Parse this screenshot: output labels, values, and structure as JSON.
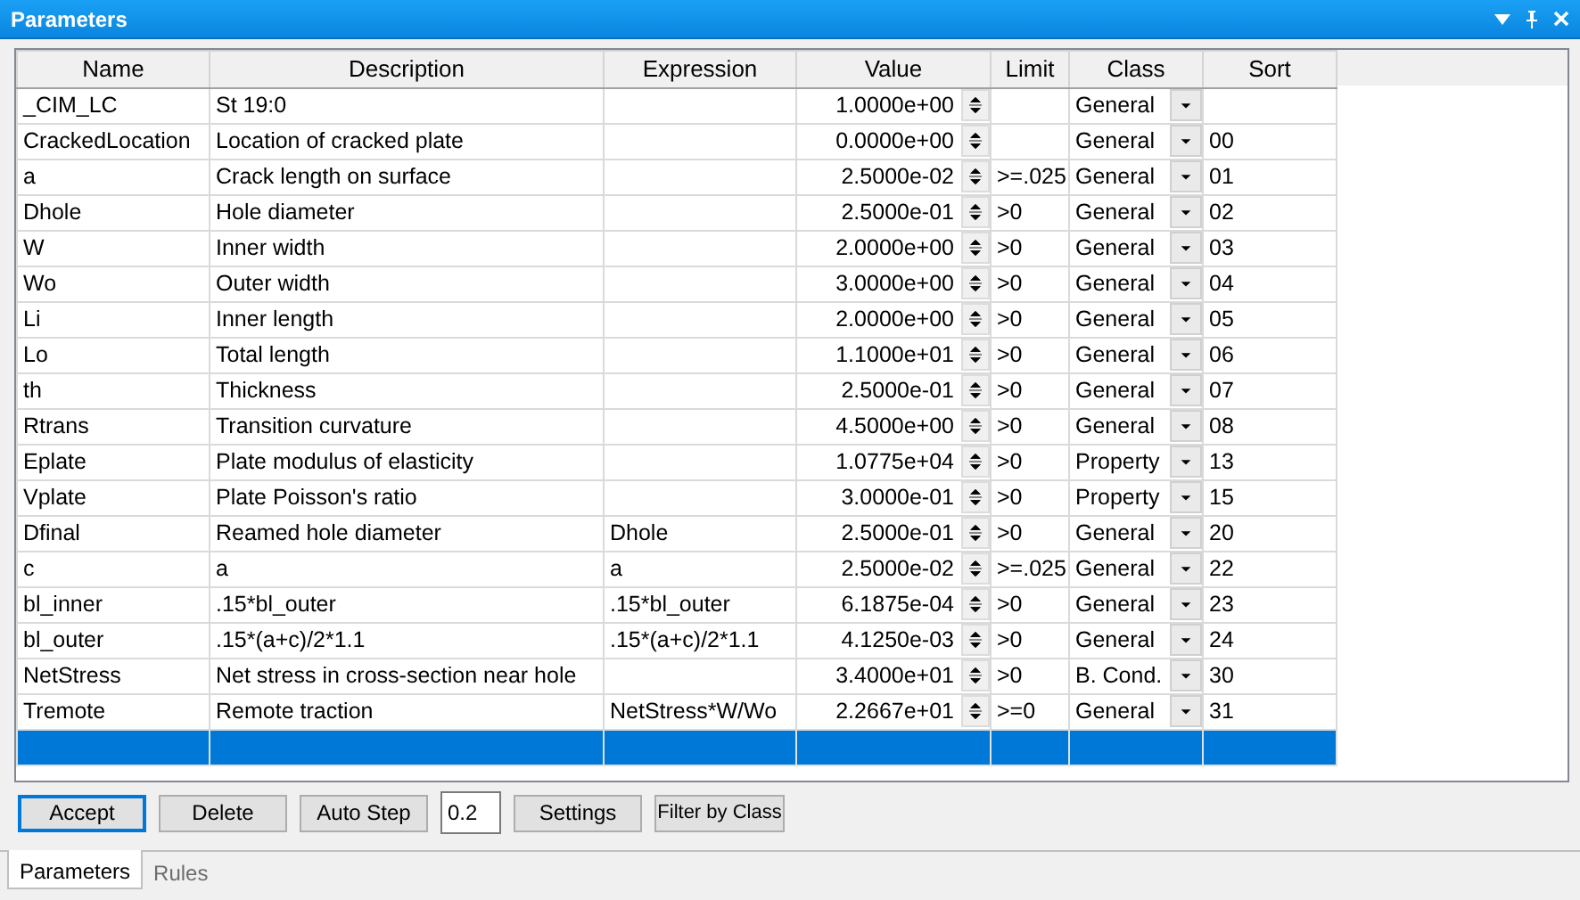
{
  "window": {
    "title": "Parameters"
  },
  "table": {
    "columns": [
      "Name",
      "Description",
      "Expression",
      "Value",
      "Limit",
      "Class",
      "Sort"
    ],
    "rows": [
      {
        "name": "_CIM_LC",
        "description": "St 19:0",
        "value": "1.0000e+00",
        "class": "General",
        "selected": false
      },
      {
        "name": "CrackedLocation",
        "description": "Location of cracked plate",
        "value": "0.0000e+00",
        "class": "General",
        "sort": "00",
        "selected": false
      },
      {
        "name": "a",
        "description": "Crack length on surface",
        "value": "2.5000e-02",
        "limit": ">=.025",
        "class": "General",
        "sort": "01",
        "selected": false
      },
      {
        "name": "Dhole",
        "description": "Hole diameter",
        "value": "2.5000e-01",
        "limit": ">0",
        "class": "General",
        "sort": "02",
        "selected": false
      },
      {
        "name": "W",
        "description": "Inner width",
        "value": "2.0000e+00",
        "limit": ">0",
        "class": "General",
        "sort": "03",
        "selected": false
      },
      {
        "name": "Wo",
        "description": "Outer width",
        "value": "3.0000e+00",
        "limit": ">0",
        "class": "General",
        "sort": "04",
        "selected": false
      },
      {
        "name": "Li",
        "description": "Inner length",
        "value": "2.0000e+00",
        "limit": ">0",
        "class": "General",
        "sort": "05",
        "selected": false
      },
      {
        "name": "Lo",
        "description": "Total length",
        "value": "1.1000e+01",
        "limit": ">0",
        "class": "General",
        "sort": "06",
        "selected": false
      },
      {
        "name": "th",
        "description": "Thickness",
        "value": "2.5000e-01",
        "limit": ">0",
        "class": "General",
        "sort": "07",
        "selected": false
      },
      {
        "name": "Rtrans",
        "description": "Transition curvature",
        "value": "4.5000e+00",
        "limit": ">0",
        "class": "General",
        "sort": "08",
        "selected": false
      },
      {
        "name": "Eplate",
        "description": "Plate modulus of elasticity",
        "value": "1.0775e+04",
        "limit": ">0",
        "class": "Property",
        "sort": "13",
        "selected": false
      },
      {
        "name": "Vplate",
        "description": "Plate Poisson's ratio",
        "value": "3.0000e-01",
        "limit": ">0",
        "class": "Property",
        "sort": "15",
        "selected": false
      },
      {
        "name": "Dfinal",
        "description": "Reamed hole diameter",
        "expression": "Dhole",
        "value": "2.5000e-01",
        "limit": ">0",
        "class": "General",
        "sort": "20",
        "selected": false
      },
      {
        "name": "c",
        "description": "a",
        "expression": "a",
        "value": "2.5000e-02",
        "limit": ">=.025",
        "class": "General",
        "sort": "22",
        "selected": false
      },
      {
        "name": "bl_inner",
        "description": ".15*bl_outer",
        "expression": ".15*bl_outer",
        "value": "6.1875e-04",
        "limit": ">0",
        "class": "General",
        "sort": "23",
        "selected": false
      },
      {
        "name": "bl_outer",
        "description": ".15*(a+c)/2*1.1",
        "expression": ".15*(a+c)/2*1.1",
        "value": "4.1250e-03",
        "limit": ">0",
        "class": "General",
        "sort": "24",
        "selected": false
      },
      {
        "name": "NetStress",
        "description": "Net stress in cross-section near hole",
        "value": "3.4000e+01",
        "limit": ">0",
        "class": "B. Cond.",
        "sort": "30",
        "selected": false
      },
      {
        "name": "Tremote",
        "description": "Remote traction",
        "expression": "NetStress*W/Wo",
        "value": "2.2667e+01",
        "limit": ">=0",
        "class": "General",
        "sort": "31",
        "selected": false
      },
      {
        "selected": true
      }
    ]
  },
  "toolbar": [
    {
      "kind": "button",
      "label": "Accept",
      "focused": true
    },
    {
      "kind": "button",
      "label": "Delete",
      "focused": false
    },
    {
      "kind": "button",
      "label": "Auto Step",
      "focused": false
    },
    {
      "kind": "field",
      "value": "0.2"
    },
    {
      "kind": "button",
      "label": "Settings",
      "focused": false
    },
    {
      "kind": "button",
      "label": "Filter by Class",
      "focused": false
    }
  ],
  "tabs": [
    {
      "label": "Parameters",
      "selected": true
    },
    {
      "label": "Rules",
      "selected": false
    }
  ]
}
